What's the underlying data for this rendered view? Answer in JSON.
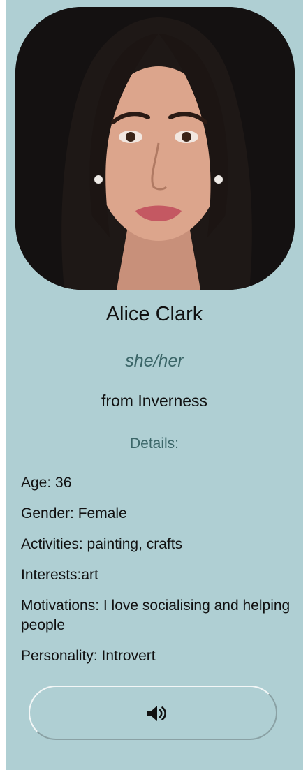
{
  "profile": {
    "name": "Alice Clark",
    "pronouns": "she/her",
    "from": "from Inverness",
    "details_heading": "Details:",
    "details": {
      "age": "Age: 36",
      "gender": "Gender: Female",
      "activities": "Activities: painting, crafts",
      "interests": "Interests:art",
      "motivations": "Motivations: I love socialising and helping people",
      "personality": "Personality: Introvert"
    }
  },
  "audio_button": {
    "icon": "speaker-icon"
  },
  "colors": {
    "card_background": "#afcfd3",
    "accent_text": "#3b6668"
  }
}
